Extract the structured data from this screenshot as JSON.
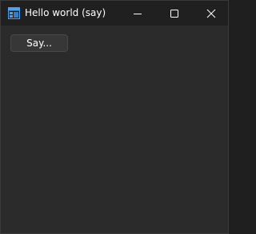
{
  "window": {
    "title": "Hello world (say)",
    "icon": "windows-app-icon",
    "accent_color": "#0078d4"
  },
  "titlebar": {
    "minimize_icon": "minimize-icon",
    "maximize_icon": "maximize-icon",
    "close_icon": "close-icon"
  },
  "content": {
    "say_button_label": "Say..."
  }
}
